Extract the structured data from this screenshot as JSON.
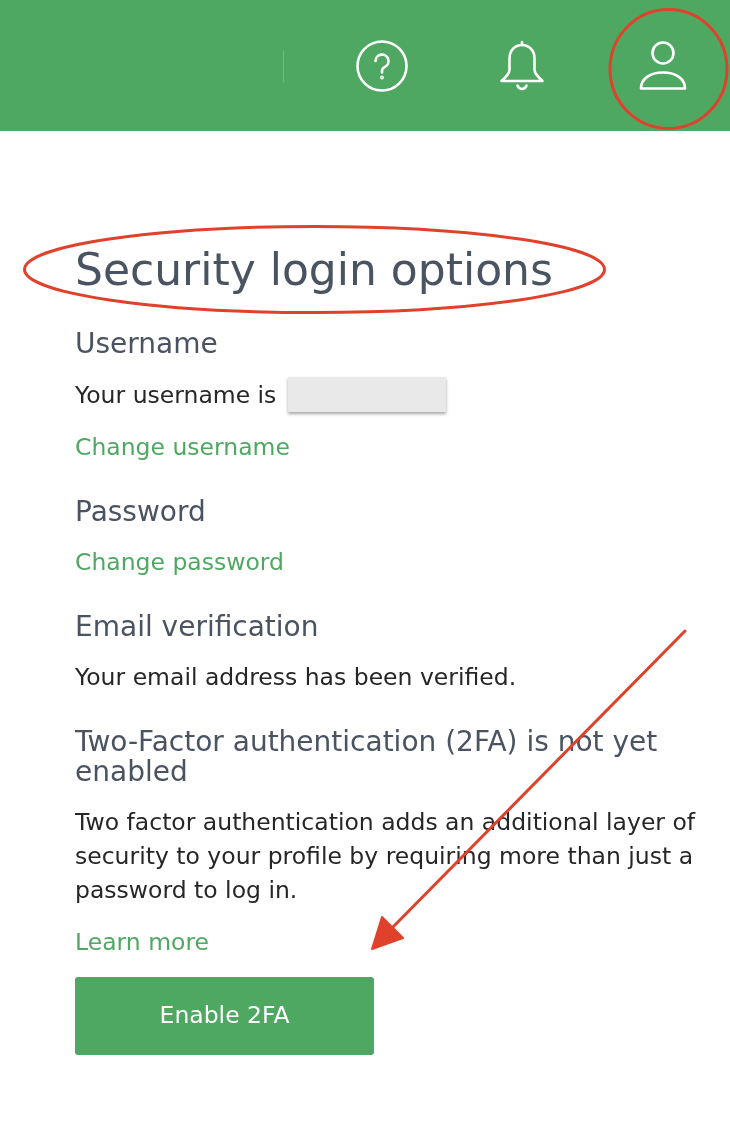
{
  "page": {
    "title": "Security login options"
  },
  "sections": [
    {
      "heading": "Username",
      "text": "Your username is",
      "redacted": true,
      "link": "Change username"
    },
    {
      "heading": "Password",
      "link": "Change password"
    },
    {
      "heading": "Email verification",
      "text": "Your email address has been verified."
    },
    {
      "heading": "Two-Factor authentication (2FA) is not yet enabled",
      "text": "Two factor authentication adds an additional layer of security to your profile by requiring more than just a password to log in.",
      "link": "Learn more",
      "button": "Enable 2FA"
    }
  ]
}
